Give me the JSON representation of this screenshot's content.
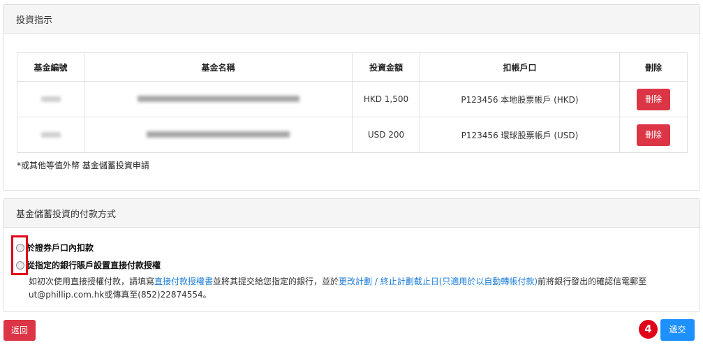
{
  "instructions_card": {
    "title": "投資指示",
    "table": {
      "headers": [
        "基金編號",
        "基金名稱",
        "投資金額",
        "扣帳戶口",
        "刪除"
      ],
      "rows": [
        {
          "amount": "HKD 1,500",
          "account": "P123456 本地股票帳戶 (HKD)",
          "delete_label": "刪除"
        },
        {
          "amount": "USD 200",
          "account": "P123456 環球股票帳戶 (USD)",
          "delete_label": "刪除"
        }
      ]
    },
    "note": "*或其他等值外幣 基金儲蓄投資申請"
  },
  "payment_card": {
    "title": "基金儲蓄投資的付款方式",
    "options": [
      {
        "label": "於證券戶口內扣款",
        "selected": false
      },
      {
        "label": "從指定的銀行賬戶設置直接付款授權",
        "selected": false
      }
    ],
    "info": {
      "part1": "如初次使用直接授權付款，請填寫",
      "link1": "直接付款授權書",
      "part2": "並將其提交給您指定的銀行，並於",
      "link2": "更改計劃 / 終止計劃截止日(只適用於以自動轉帳付款)",
      "part3": "前將銀行發出的確認信電郵至",
      "part4": "ut@phillip.com.hk或傳真至(852)22874554。"
    }
  },
  "footer": {
    "back_label": "返回",
    "submit_label": "遞交",
    "step_number": "4"
  },
  "colors": {
    "danger": "#dc3545",
    "primary": "#1e90ff",
    "highlight": "#e0001a",
    "link": "#1a7bd6"
  }
}
